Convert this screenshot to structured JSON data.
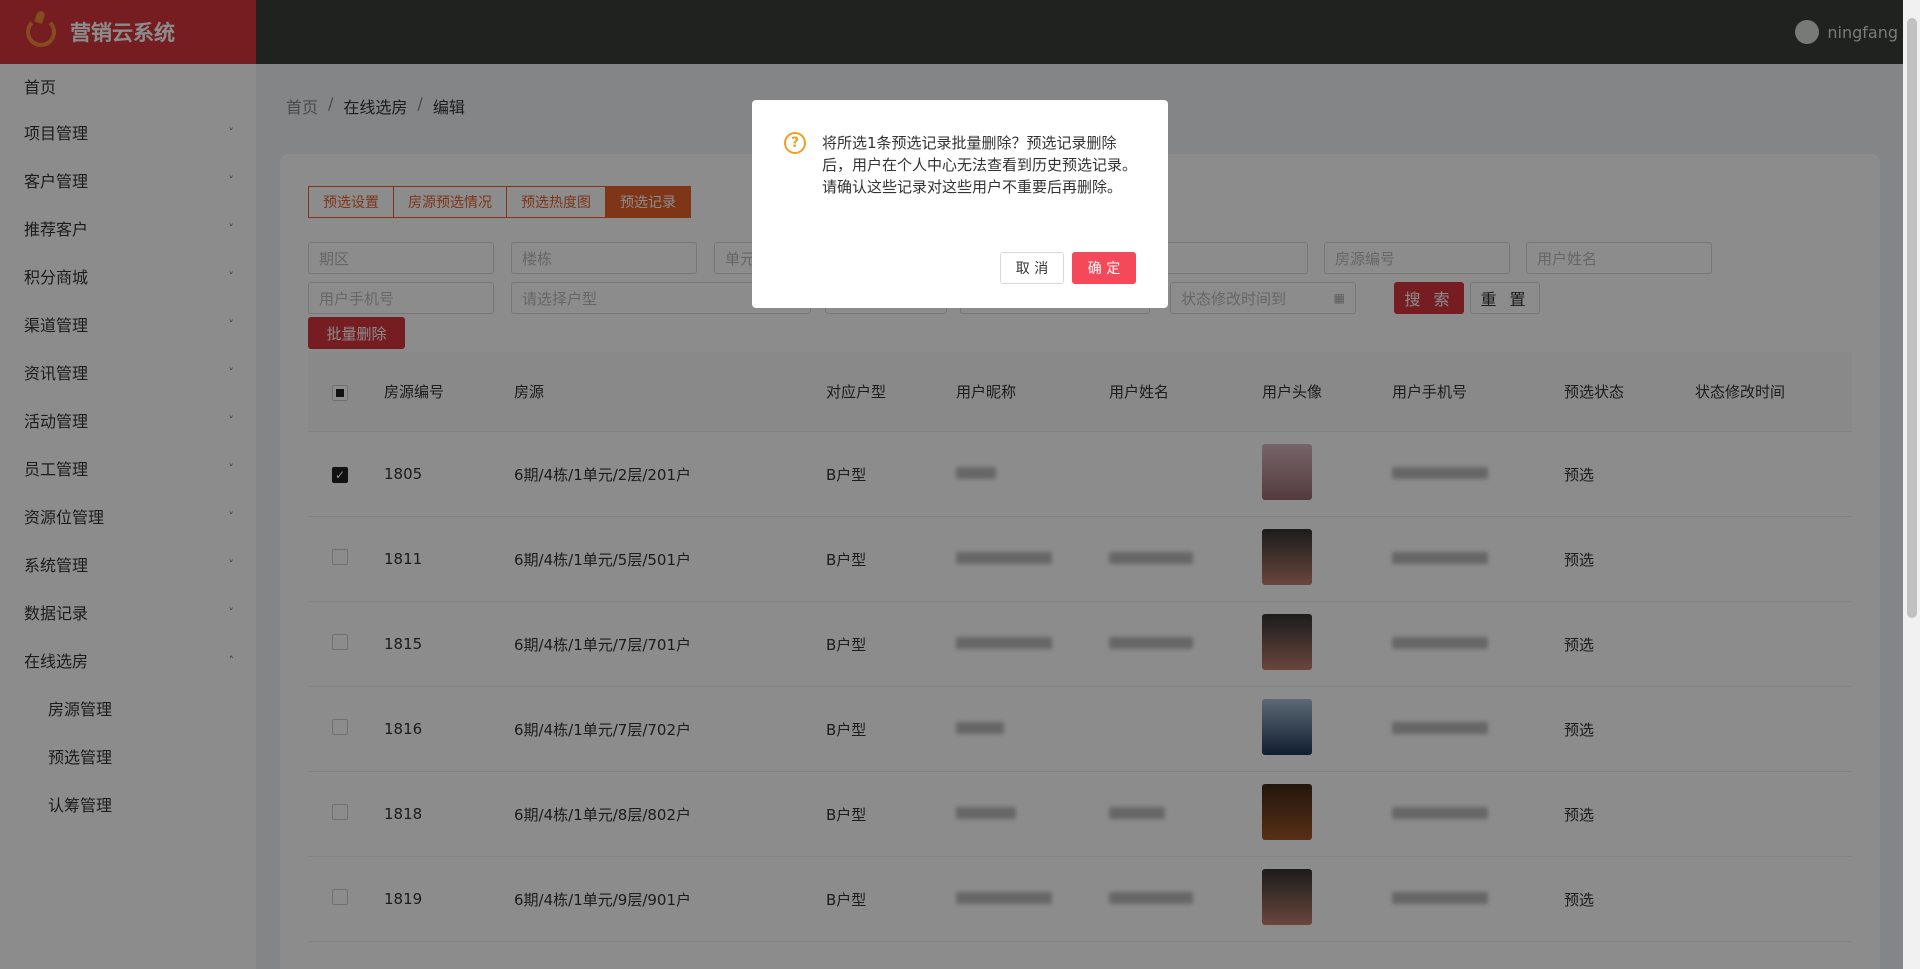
{
  "app": {
    "title": "营销云系统",
    "user": "ningfang"
  },
  "sidebar": {
    "items": [
      {
        "label": "首页",
        "chevron": ""
      },
      {
        "label": "项目管理",
        "chevron": "˅"
      },
      {
        "label": "客户管理",
        "chevron": "˅"
      },
      {
        "label": "推荐客户",
        "chevron": "˅"
      },
      {
        "label": "积分商城",
        "chevron": "˅"
      },
      {
        "label": "渠道管理",
        "chevron": "˅"
      },
      {
        "label": "资讯管理",
        "chevron": "˅"
      },
      {
        "label": "活动管理",
        "chevron": "˅"
      },
      {
        "label": "员工管理",
        "chevron": "˅"
      },
      {
        "label": "资源位管理",
        "chevron": "˅"
      },
      {
        "label": "系统管理",
        "chevron": "˅"
      },
      {
        "label": "数据记录",
        "chevron": "˅"
      },
      {
        "label": "在线选房",
        "chevron": "˄"
      }
    ],
    "sub_items": [
      "房源管理",
      "预选管理",
      "认筹管理"
    ]
  },
  "breadcrumb": {
    "home": "首页",
    "sep": "/",
    "level1": "在线选房",
    "current": "编辑"
  },
  "tabs": [
    "预选设置",
    "房源预选情况",
    "预选热度图",
    "预选记录"
  ],
  "filters": {
    "period": "期区",
    "building": "楼栋",
    "unit": "单元",
    "room_no": "房源编号",
    "user_name": "用户姓名",
    "phone": "用户手机号",
    "house_type": "请选择户型",
    "modify_time_end": "状态修改时间到",
    "search": "搜 索",
    "reset": "重 置"
  },
  "batch_delete": "批量删除",
  "table": {
    "headers": [
      "房源编号",
      "房源",
      "对应户型",
      "用户昵称",
      "用户姓名",
      "用户头像",
      "用户手机号",
      "预选状态",
      "状态修改时间"
    ],
    "rows": [
      {
        "id": "1805",
        "room": "6期/4栋/1单元/2层/201户",
        "type": "B户型",
        "status": "预选",
        "checked": true
      },
      {
        "id": "1811",
        "room": "6期/4栋/1单元/5层/501户",
        "type": "B户型",
        "status": "预选",
        "checked": false
      },
      {
        "id": "1815",
        "room": "6期/4栋/1单元/7层/701户",
        "type": "B户型",
        "status": "预选",
        "checked": false
      },
      {
        "id": "1816",
        "room": "6期/4栋/1单元/7层/702户",
        "type": "B户型",
        "status": "预选",
        "checked": false
      },
      {
        "id": "1818",
        "room": "6期/4栋/1单元/8层/802户",
        "type": "B户型",
        "status": "预选",
        "checked": false
      },
      {
        "id": "1819",
        "room": "6期/4栋/1单元/9层/901户",
        "type": "B户型",
        "status": "预选",
        "checked": false
      }
    ]
  },
  "dialog": {
    "icon": "?",
    "message": "将所选1条预选记录批量删除？预选记录删除后，用户在个人中心无法查看到历史预选记录。请确认这些记录对这些用户不重要后再删除。",
    "cancel": "取 消",
    "confirm": "确 定"
  },
  "colors": {
    "brand": "#d7363f",
    "accent": "#e8612c",
    "confirm": "#f5495a",
    "warning": "#f0a020"
  }
}
